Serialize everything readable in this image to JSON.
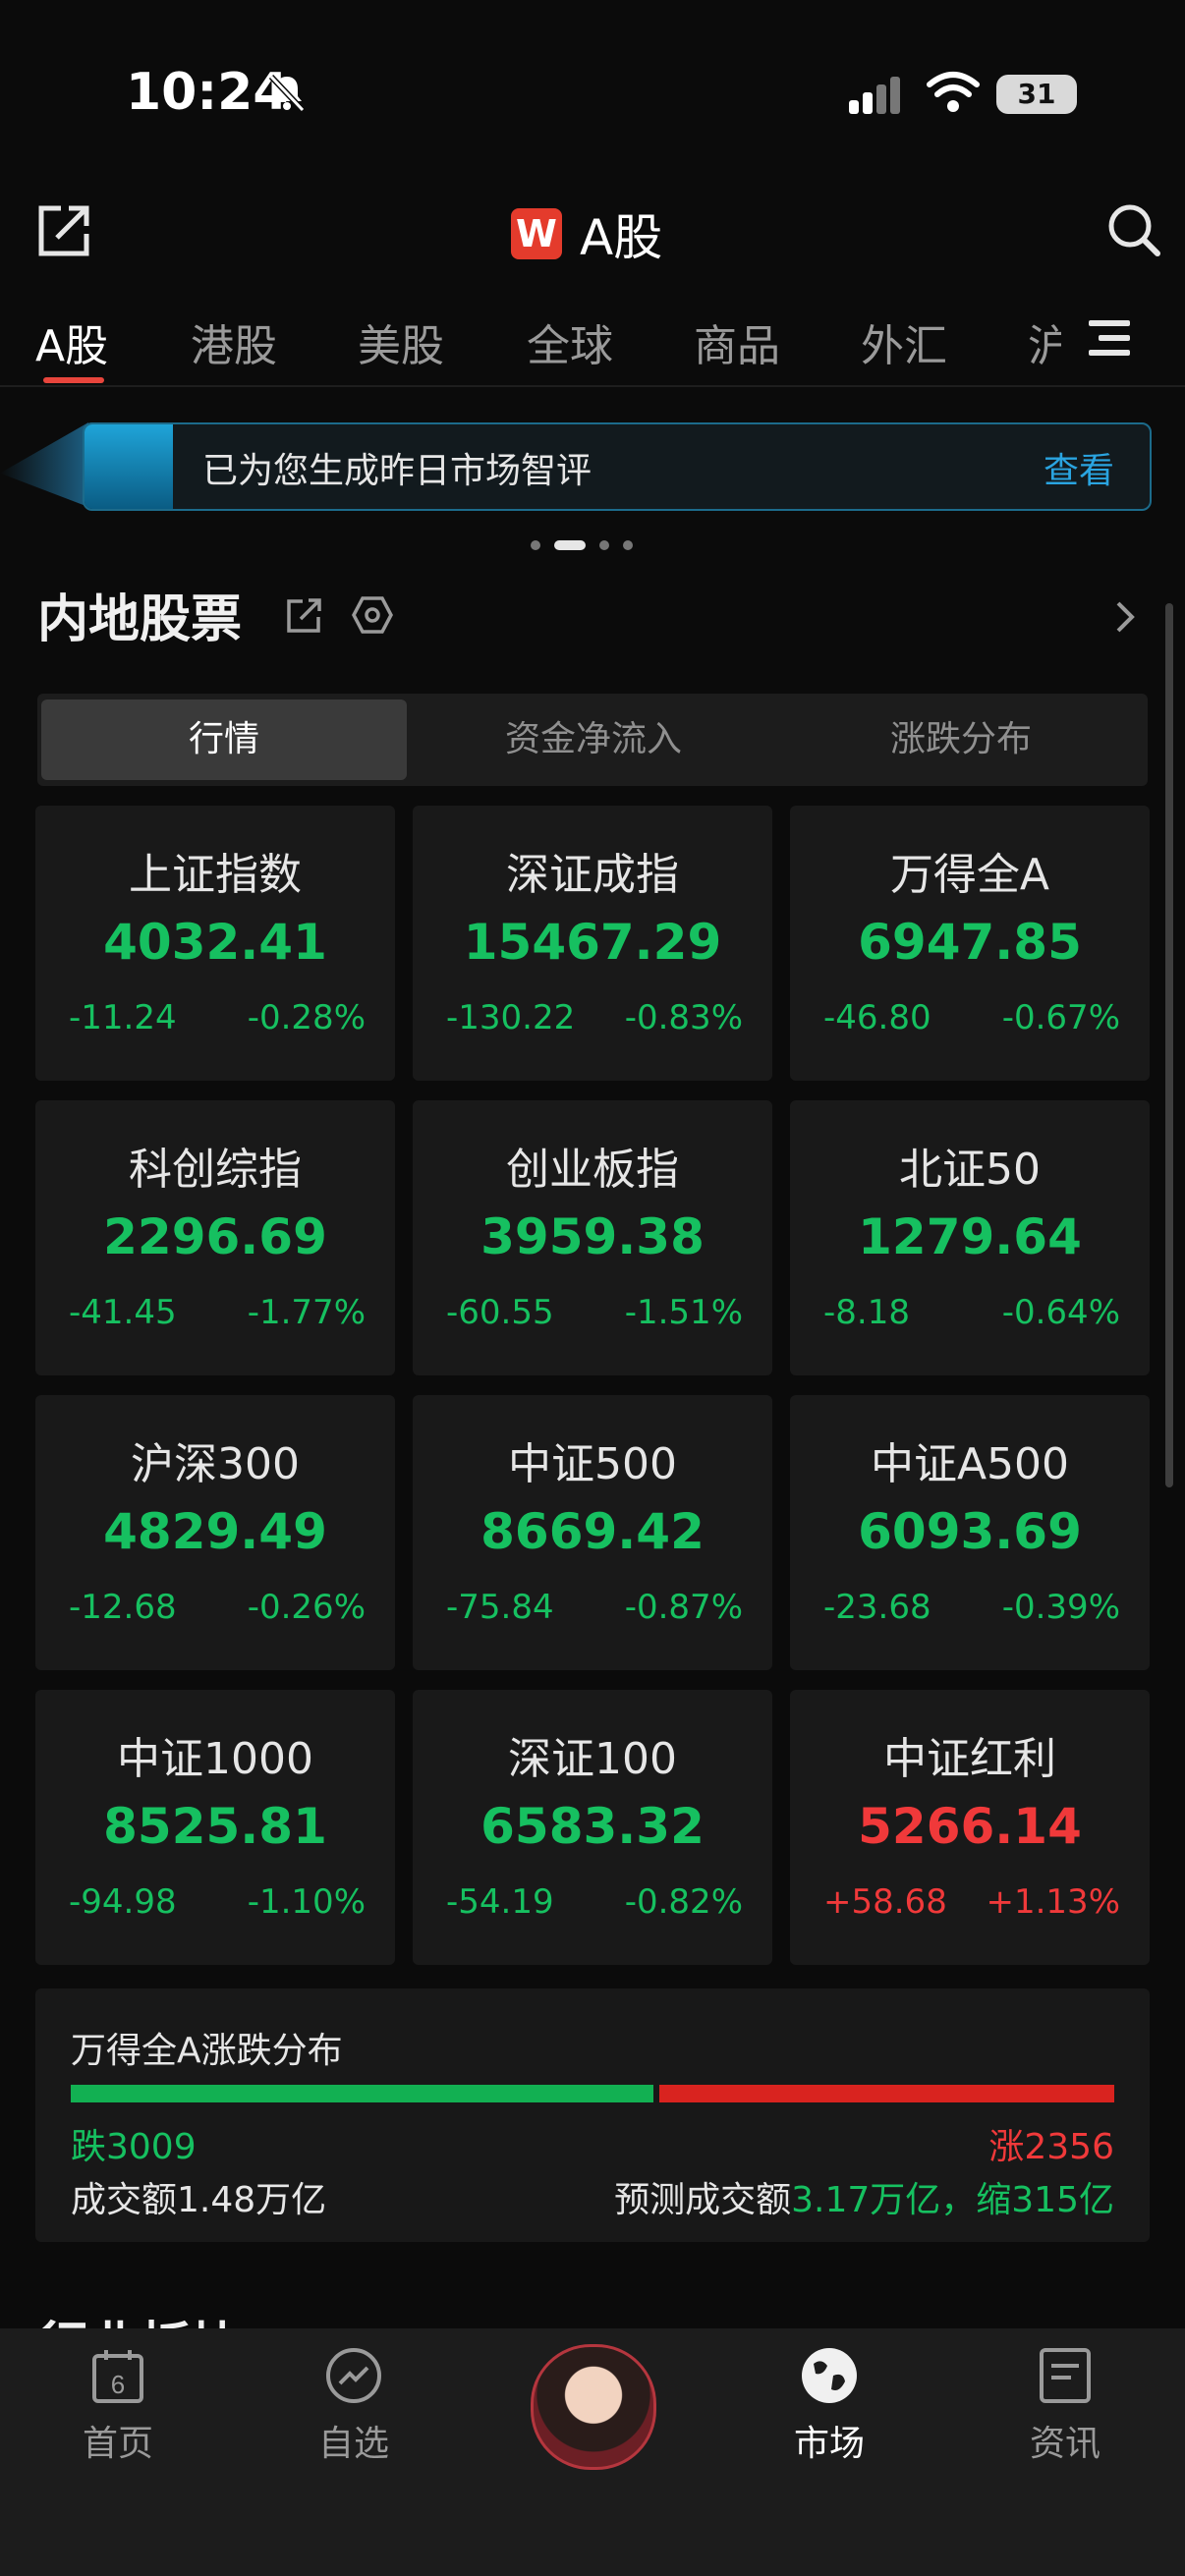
{
  "status": {
    "time": "10:24",
    "battery": "31"
  },
  "header": {
    "logo_letter": "W",
    "title": "A股"
  },
  "tabs": [
    {
      "label": "A股"
    },
    {
      "label": "港股"
    },
    {
      "label": "美股"
    },
    {
      "label": "全球"
    },
    {
      "label": "商品"
    },
    {
      "label": "外汇"
    },
    {
      "label": "沪"
    }
  ],
  "banner": {
    "text": "已为您生成昨日市场智评",
    "link": "查看"
  },
  "section": {
    "title": "内地股票"
  },
  "segments": [
    {
      "label": "行情"
    },
    {
      "label": "资金净流入"
    },
    {
      "label": "涨跌分布"
    }
  ],
  "indices": [
    {
      "name": "上证指数",
      "value": "4032.41",
      "change": "-11.24",
      "pct": "-0.28%",
      "dir": "down"
    },
    {
      "name": "深证成指",
      "value": "15467.29",
      "change": "-130.22",
      "pct": "-0.83%",
      "dir": "down"
    },
    {
      "name": "万得全A",
      "value": "6947.85",
      "change": "-46.80",
      "pct": "-0.67%",
      "dir": "down"
    },
    {
      "name": "科创综指",
      "value": "2296.69",
      "change": "-41.45",
      "pct": "-1.77%",
      "dir": "down"
    },
    {
      "name": "创业板指",
      "value": "3959.38",
      "change": "-60.55",
      "pct": "-1.51%",
      "dir": "down"
    },
    {
      "name": "北证50",
      "value": "1279.64",
      "change": "-8.18",
      "pct": "-0.64%",
      "dir": "down"
    },
    {
      "name": "沪深300",
      "value": "4829.49",
      "change": "-12.68",
      "pct": "-0.26%",
      "dir": "down"
    },
    {
      "name": "中证500",
      "value": "8669.42",
      "change": "-75.84",
      "pct": "-0.87%",
      "dir": "down"
    },
    {
      "name": "中证A500",
      "value": "6093.69",
      "change": "-23.68",
      "pct": "-0.39%",
      "dir": "down"
    },
    {
      "name": "中证1000",
      "value": "8525.81",
      "change": "-94.98",
      "pct": "-1.10%",
      "dir": "down"
    },
    {
      "name": "深证100",
      "value": "6583.32",
      "change": "-54.19",
      "pct": "-0.82%",
      "dir": "down"
    },
    {
      "name": "中证红利",
      "value": "5266.14",
      "change": "+58.68",
      "pct": "+1.13%",
      "dir": "up"
    }
  ],
  "distribution": {
    "title": "万得全A涨跌分布",
    "down_label": "跌3009",
    "up_label": "涨2356",
    "down_count": 3009,
    "up_count": 2356,
    "turnover": "成交额1.48万亿",
    "forecast_prefix": "预测成交额",
    "forecast_value": "3.17万亿，缩315亿"
  },
  "next_section_partial": "行业板块",
  "nav": [
    {
      "label": "首页",
      "icon": "calendar-icon",
      "badge": "6"
    },
    {
      "label": "自选",
      "icon": "trend-icon"
    },
    {
      "label": "",
      "icon": "avatar"
    },
    {
      "label": "市场",
      "icon": "globe-icon"
    },
    {
      "label": "资讯",
      "icon": "news-icon"
    }
  ],
  "colors": {
    "up": "#f0393a",
    "down": "#16c060",
    "accent": "#e8453c",
    "link": "#2aa4e0"
  }
}
